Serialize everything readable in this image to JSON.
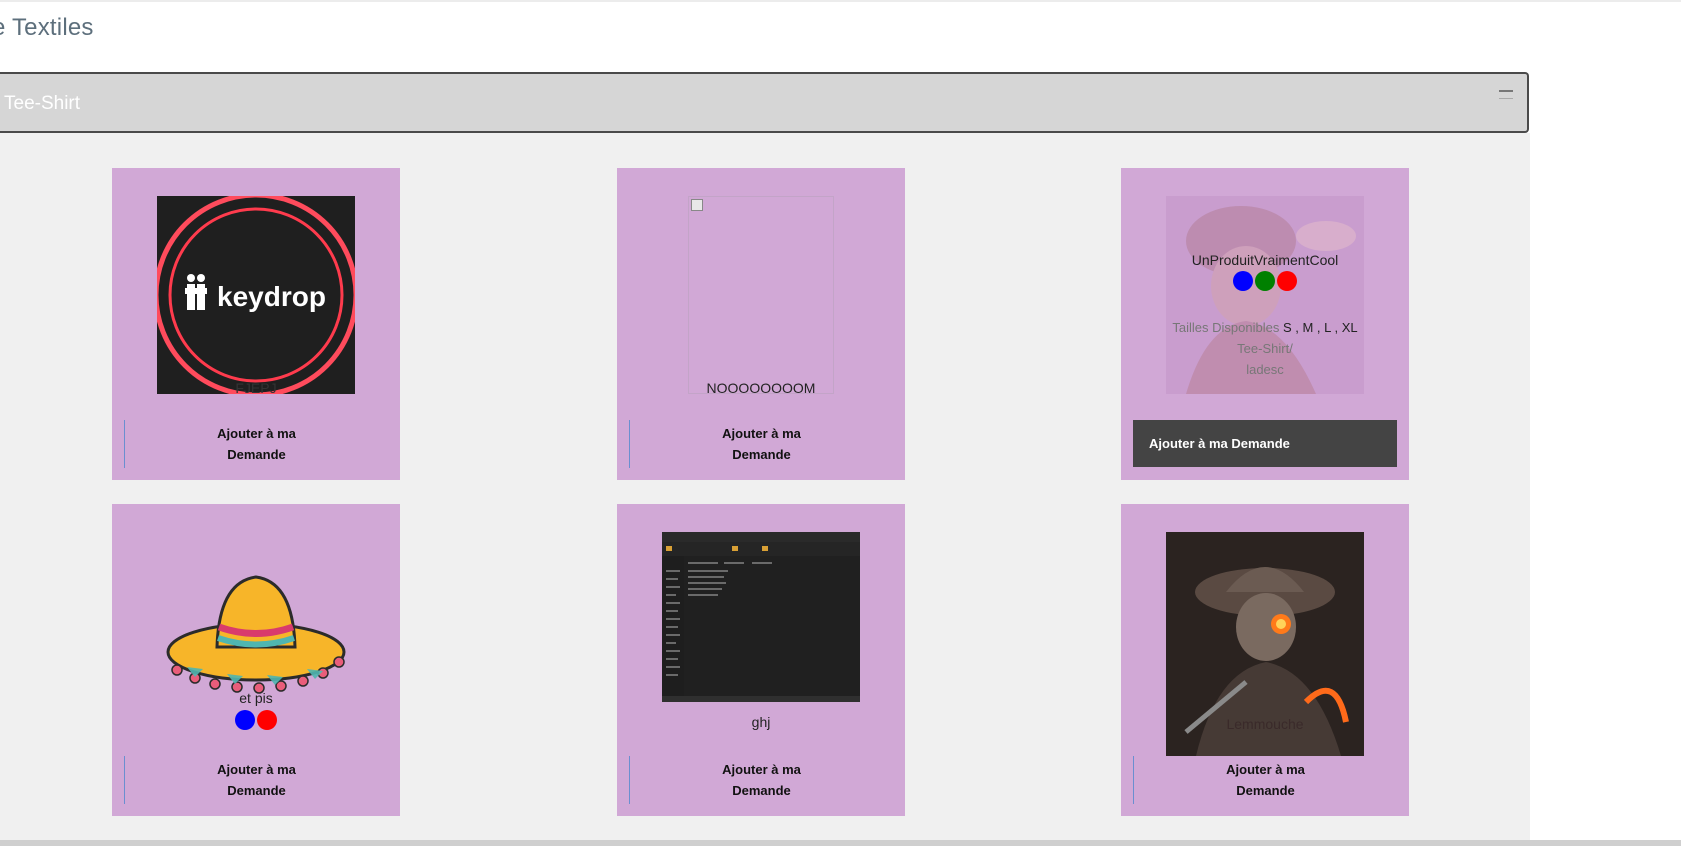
{
  "page": {
    "title": "e Textiles"
  },
  "section": {
    "title": "Tee-Shirt"
  },
  "cards": [
    {
      "label": "FJEPJ",
      "image": "keydrop",
      "logo_text": "keydrop",
      "button_line1": "Ajouter à ma",
      "button_line2": "Demande"
    },
    {
      "label": "NOOOOOOOOM",
      "image": "broken",
      "button_line1": "Ajouter à ma",
      "button_line2": "Demande"
    },
    {
      "label": "UnProduitVraimentCool",
      "image": "faded-character",
      "colors": [
        "#0000ff",
        "#008000",
        "#ff0000"
      ],
      "sizes_label": "Tailles Disponibles",
      "sizes_value": "S , M , L , XL",
      "category": "Tee-Shirt/",
      "description": "ladesc",
      "button_label": "Ajouter à ma Demande"
    },
    {
      "label": "et pis",
      "image": "sombrero",
      "colors": [
        "#0000ff",
        "#ff0000"
      ],
      "button_line1": "Ajouter à ma",
      "button_line2": "Demande"
    },
    {
      "label": "ghj",
      "image": "dark-screenshot",
      "button_line1": "Ajouter à ma",
      "button_line2": "Demande"
    },
    {
      "label": "Lemmouche",
      "image": "cowboy-character",
      "button_line1": "Ajouter à ma",
      "button_line2": "Demande"
    }
  ]
}
